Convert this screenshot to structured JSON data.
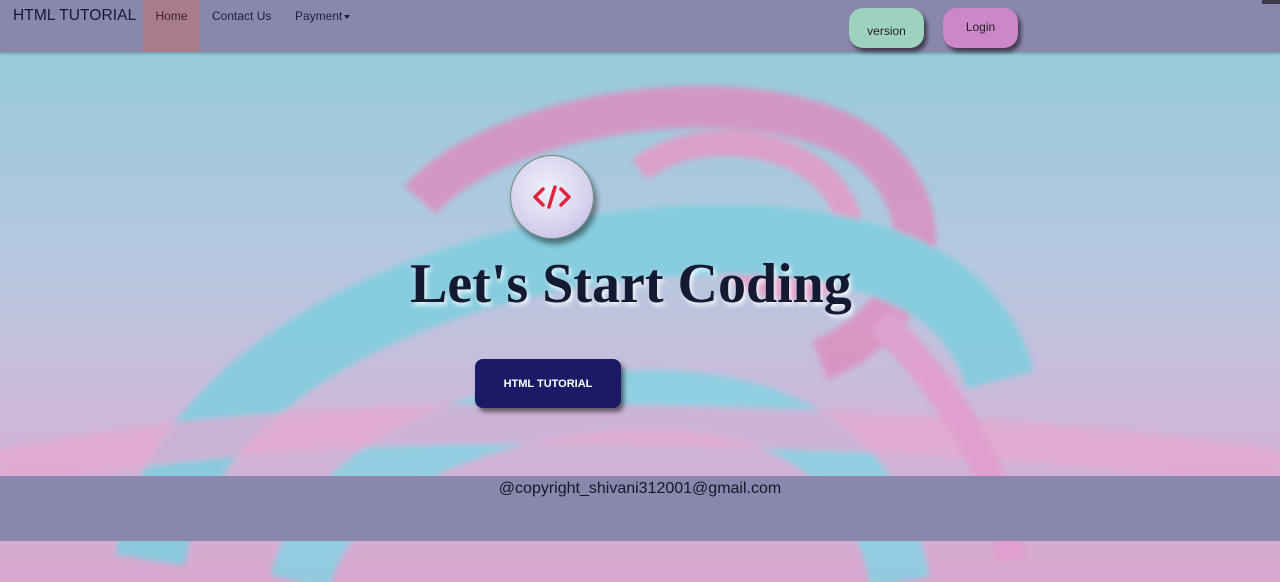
{
  "navbar": {
    "brand": "HTML TUTORIAL",
    "items": [
      {
        "label": "Home",
        "active": true
      },
      {
        "label": "Contact Us"
      },
      {
        "label": "Payment",
        "dropdown": true
      }
    ],
    "version_label": "version",
    "login_label": "Login"
  },
  "hero": {
    "icon": "code-icon",
    "headline": "Let's Start Coding",
    "cta_label": "HTML TUTORIAL"
  },
  "footer": {
    "copyright": "@copyright_shivani312001@gmail.com"
  },
  "colors": {
    "navbar_bg": "#8987ae",
    "home_active_bg": "#a97c8c",
    "version_bg": "#9fd1bf",
    "login_bg": "#cd86c7",
    "cta_bg": "#1a1a66",
    "icon_red": "#e0243e"
  }
}
